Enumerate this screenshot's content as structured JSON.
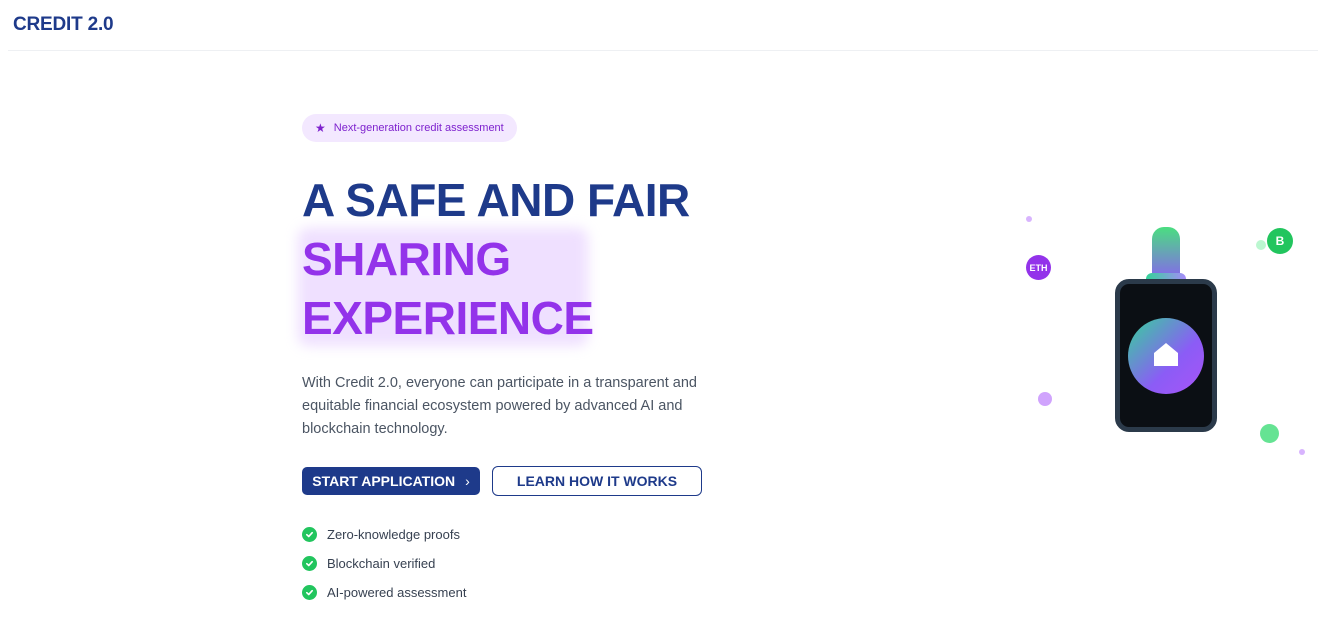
{
  "header": {
    "logo": "CREDIT 2.0"
  },
  "hero": {
    "badge": {
      "icon": "star-icon",
      "label": "Next-generation credit assessment"
    },
    "headline": [
      "A SAFE AND FAIR",
      "SHARING",
      "EXPERIENCE"
    ],
    "description": "With Credit 2.0, everyone can participate in a transparent and equitable financial ecosystem powered by advanced AI and blockchain technology.",
    "primary_button": {
      "label": "START APPLICATION",
      "icon": "chevron-right-icon"
    },
    "secondary_button": {
      "label": "LEARN HOW IT WORKS"
    },
    "features": [
      {
        "label": "Zero-knowledge proofs",
        "icon": "check-circle-icon"
      },
      {
        "label": "Blockchain verified",
        "icon": "check-circle-icon"
      },
      {
        "label": "AI-powered assessment",
        "icon": "check-circle-icon"
      }
    ]
  },
  "illustration": {
    "coins": [
      {
        "label": "ETH",
        "color": "#9333ea"
      },
      {
        "label": "B",
        "color": "#22c55e"
      }
    ],
    "device_icon": "home-icon"
  },
  "colors": {
    "brand_navy": "#1e3a8a",
    "accent_purple": "#9333ea",
    "badge_bg": "#f3e8ff",
    "success_green": "#22c55e"
  }
}
